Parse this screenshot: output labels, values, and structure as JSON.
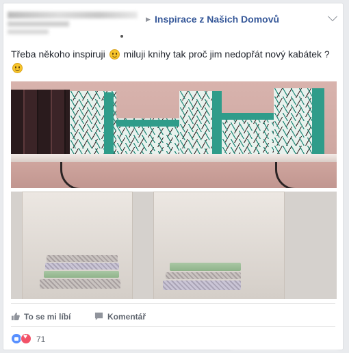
{
  "header": {
    "author": "",
    "arrow": "▶",
    "group_name": "Inspirace z Našich Domovů"
  },
  "post": {
    "text_before_emoji": "Třeba někoho inspiruji",
    "text_after_emoji": " miluji knihy tak proč jim nedopřát nový kabátek ?"
  },
  "images": [
    {
      "icon": "photo-bookshelf-shelf"
    },
    {
      "icon": "photo-bookshelf-cubbies"
    }
  ],
  "actions": {
    "like_label": "To se mi líbí",
    "comment_label": "Komentář"
  },
  "reactions": {
    "count": "71",
    "types": [
      "like",
      "love"
    ]
  },
  "colors": {
    "link": "#365899",
    "like_blue": "#5890ff",
    "love_red": "#f25268",
    "teal_book": "#2f9c8a"
  }
}
